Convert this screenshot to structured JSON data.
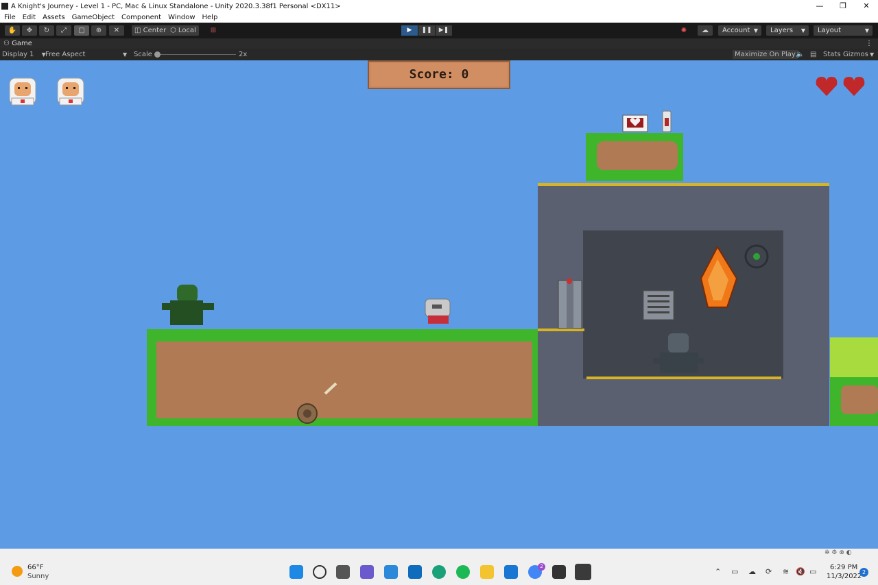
{
  "window": {
    "title": "A Knight's Journey - Level 1 - PC, Mac & Linux Standalone - Unity 2020.3.38f1 Personal <DX11>",
    "minimize": "—",
    "maximize": "❐",
    "close": "✕"
  },
  "menu": [
    "File",
    "Edit",
    "Assets",
    "GameObject",
    "Component",
    "Window",
    "Help"
  ],
  "toolbar": {
    "tools": [
      "hand-icon",
      "move-icon",
      "rotate-icon",
      "scale-icon",
      "rect-icon",
      "transform-icon",
      "custom-tool-icon"
    ],
    "pivot": "Center",
    "space": "Local",
    "play": "▶",
    "pause": "❚❚",
    "step": "▶❚",
    "account": "Account",
    "layers": "Layers",
    "layout": "Layout"
  },
  "game_tab": {
    "label": "Game",
    "menu": "⋮"
  },
  "game_bar": {
    "display": "Display 1",
    "aspect": "Free Aspect",
    "scale_label": "Scale",
    "scale_value": "2x",
    "maximize": "Maximize On Play",
    "stats": "Stats",
    "gizmos": "Gizmos"
  },
  "hud": {
    "score_text": "Score: 0",
    "lives": 2,
    "hearts": 2
  },
  "taskbar": {
    "temp": "66°F",
    "weather": "Sunny",
    "time": "6:29 PM",
    "date": "11/3/2022",
    "notifications": "2",
    "badge": "2"
  },
  "colors": {
    "sky": "#5e9be5",
    "grass": "#3fb52c",
    "dirt": "#b07a55",
    "stone": "#5a6070"
  }
}
